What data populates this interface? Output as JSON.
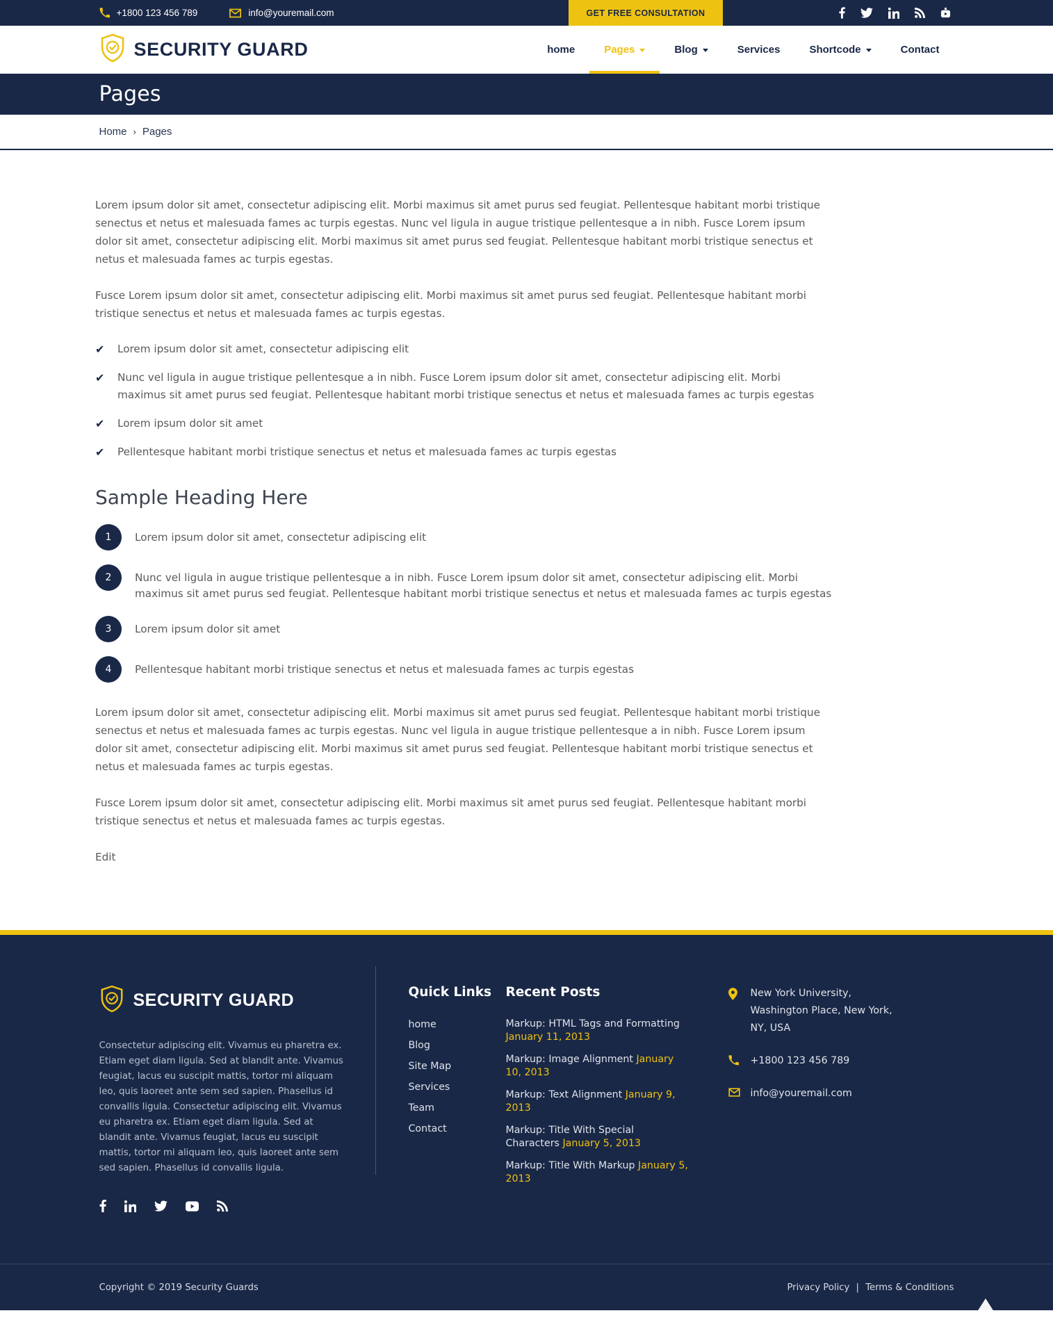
{
  "topbar": {
    "phone": "+1800 123 456 789",
    "email": "info@youremail.com",
    "cta_label": "GET FREE CONSULTATION",
    "social": [
      {
        "name": "facebook-icon",
        "label": "Facebook"
      },
      {
        "name": "twitter-icon",
        "label": "Twitter"
      },
      {
        "name": "linkedin-icon",
        "label": "LinkedIn"
      },
      {
        "name": "rss-icon",
        "label": "RSS"
      },
      {
        "name": "youtube-icon",
        "label": "YouTube"
      }
    ]
  },
  "header": {
    "brand": "SECURITY GUARD",
    "menu": [
      {
        "label": "home",
        "active": false,
        "caret": false
      },
      {
        "label": "Pages",
        "active": true,
        "caret": true
      },
      {
        "label": "Blog",
        "active": false,
        "caret": true
      },
      {
        "label": "Services",
        "active": false,
        "caret": false
      },
      {
        "label": "Shortcode",
        "active": false,
        "caret": true
      },
      {
        "label": "Contact",
        "active": false,
        "caret": false
      }
    ]
  },
  "page": {
    "title": "Pages",
    "breadcrumb": {
      "home": "Home",
      "separator": "›",
      "current": "Pages"
    }
  },
  "main": {
    "paragraph_1": "Lorem ipsum dolor sit amet, consectetur adipiscing elit. Morbi maximus sit amet purus sed feugiat. Pellentesque habitant morbi tristique senectus et netus et malesuada fames ac turpis egestas. Nunc vel ligula in augue tristique pellentesque a in nibh. Fusce Lorem ipsum dolor sit amet, consectetur adipiscing elit. Morbi maximus sit amet purus sed feugiat. Pellentesque habitant morbi tristique senectus et netus et malesuada fames ac turpis egestas.",
    "paragraph_2": "Fusce Lorem ipsum dolor sit amet, consectetur adipiscing elit. Morbi maximus sit amet purus sed feugiat. Pellentesque habitant morbi tristique senectus et netus et malesuada fames ac turpis egestas.",
    "check_list": [
      "Lorem ipsum dolor sit amet, consectetur adipiscing elit",
      "Nunc vel ligula in augue tristique pellentesque a in nibh. Fusce Lorem ipsum dolor sit amet, consectetur adipiscing elit. Morbi maximus sit amet purus sed feugiat. Pellentesque habitant morbi tristique senectus et netus et malesuada fames ac turpis egestas",
      "Lorem ipsum dolor sit amet",
      "Pellentesque habitant morbi tristique senectus et netus et malesuada fames ac turpis egestas"
    ],
    "heading": "Sample Heading Here",
    "numbered_list": [
      {
        "num": "1",
        "text": "Lorem ipsum dolor sit amet, consectetur adipiscing elit"
      },
      {
        "num": "2",
        "text": "Nunc vel ligula in augue tristique pellentesque a in nibh. Fusce Lorem ipsum dolor sit amet, consectetur adipiscing elit. Morbi maximus sit amet purus sed feugiat. Pellentesque habitant morbi tristique senectus et netus et malesuada fames ac turpis egestas"
      },
      {
        "num": "3",
        "text": "Lorem ipsum dolor sit amet"
      },
      {
        "num": "4",
        "text": "Pellentesque habitant morbi tristique senectus et netus et malesuada fames ac turpis egestas"
      }
    ],
    "paragraph_3": "Lorem ipsum dolor sit amet, consectetur adipiscing elit. Morbi maximus sit amet purus sed feugiat. Pellentesque habitant morbi tristique senectus et netus et malesuada fames ac turpis egestas. Nunc vel ligula in augue tristique pellentesque a in nibh. Fusce Lorem ipsum dolor sit amet, consectetur adipiscing elit. Morbi maximus sit amet purus sed feugiat. Pellentesque habitant morbi tristique senectus et netus et malesuada fames ac turpis egestas.",
    "paragraph_4": "Fusce Lorem ipsum dolor sit amet, consectetur adipiscing elit. Morbi maximus sit amet purus sed feugiat. Pellentesque habitant morbi tristique senectus et netus et malesuada fames ac turpis egestas.",
    "edit_label": "Edit"
  },
  "footer": {
    "brand": "SECURITY GUARD",
    "about": "Consectetur adipiscing elit. Vivamus eu pharetra ex. Etiam eget diam ligula. Sed at blandit ante. Vivamus feugiat, lacus eu suscipit mattis, tortor mi aliquam leo, quis laoreet ante sem sed sapien. Phasellus id convallis ligula. Consectetur adipiscing elit. Vivamus eu pharetra ex. Etiam eget diam ligula. Sed at blandit ante. Vivamus feugiat, lacus eu suscipit mattis, tortor mi aliquam leo, quis laoreet ante sem sed sapien. Phasellus id convallis ligula.",
    "social": [
      {
        "name": "facebook-icon",
        "label": "Facebook"
      },
      {
        "name": "linkedin-icon",
        "label": "LinkedIn"
      },
      {
        "name": "twitter-icon",
        "label": "Twitter"
      },
      {
        "name": "youtube-icon",
        "label": "YouTube"
      },
      {
        "name": "rss-icon",
        "label": "RSS"
      }
    ],
    "quick_links_heading": "Quick Links",
    "quick_links": [
      "home",
      "Blog",
      "Site Map",
      "Services",
      "Team",
      "Contact"
    ],
    "recent_posts_heading": "Recent Posts",
    "recent_posts": [
      {
        "title": "Markup: HTML Tags and Formatting",
        "date": "January 11, 2013"
      },
      {
        "title": "Markup: Image Alignment",
        "date": "January 10, 2013"
      },
      {
        "title": "Markup: Text Alignment",
        "date": "January 9, 2013"
      },
      {
        "title": "Markup: Title With Special Characters",
        "date": "January 5, 2013"
      },
      {
        "title": "Markup: Title With Markup",
        "date": "January 5, 2013"
      }
    ],
    "contact": {
      "address": "New York University, Washington Place, New York, NY, USA",
      "phone": "+1800 123 456 789",
      "email": "info@youremail.com"
    },
    "copyright": "Copyright © 2019 Security Guards",
    "privacy_label": "Privacy Policy",
    "pipe": "|",
    "terms_label": "Terms & Conditions"
  },
  "colors": {
    "navy": "#1a2847",
    "gold": "#eec211",
    "body_text": "#5a5a5a",
    "white": "#ffffff"
  }
}
